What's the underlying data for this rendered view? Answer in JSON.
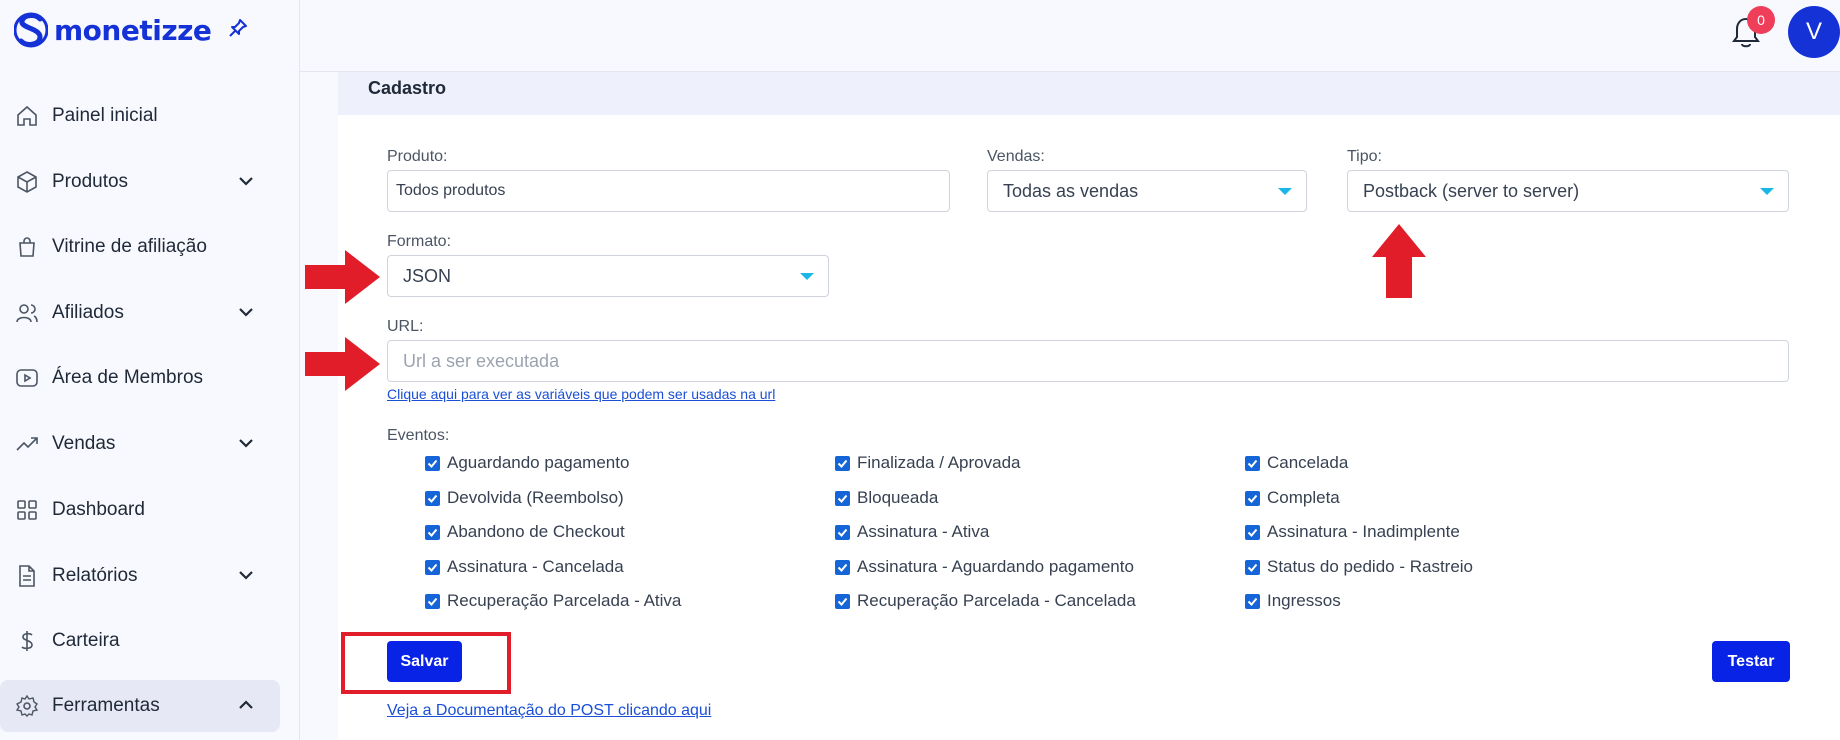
{
  "brand": "monetizze",
  "sidebar": {
    "items": [
      {
        "label": "Painel inicial",
        "icon": "home-icon"
      },
      {
        "label": "Produtos",
        "icon": "box-icon"
      },
      {
        "label": "Vitrine de afiliação",
        "icon": "shopping-bag-icon"
      },
      {
        "label": "Afiliados",
        "icon": "users-icon"
      },
      {
        "label": "Área de Membros",
        "icon": "play-icon"
      },
      {
        "label": "Vendas",
        "icon": "trending-up-icon"
      },
      {
        "label": "Dashboard",
        "icon": "grid-icon"
      },
      {
        "label": "Relatórios",
        "icon": "document-icon"
      },
      {
        "label": "Carteira",
        "icon": "dollar-icon"
      },
      {
        "label": "Ferramentas",
        "icon": "gear-icon"
      }
    ]
  },
  "topbar": {
    "notification_count": "0",
    "avatar_initial": "V"
  },
  "card": {
    "title": "Cadastro"
  },
  "form": {
    "produto_label": "Produto:",
    "produto_value": "Todos produtos",
    "vendas_label": "Vendas:",
    "vendas_value": "Todas as vendas",
    "tipo_label": "Tipo:",
    "tipo_value": "Postback (server to server)",
    "formato_label": "Formato:",
    "formato_value": "JSON",
    "url_label": "URL:",
    "url_placeholder": "Url a ser executada",
    "url_help_link": "Clique aqui para ver as variáveis que podem ser usadas na url",
    "eventos_label": "Eventos:"
  },
  "events": {
    "col1": [
      "Aguardando pagamento",
      "Devolvida (Reembolso)",
      "Abandono de Checkout",
      "Assinatura - Cancelada",
      "Recuperação Parcelada - Ativa"
    ],
    "col2": [
      "Finalizada / Aprovada",
      "Bloqueada",
      "Assinatura - Ativa",
      "Assinatura - Aguardando pagamento",
      "Recuperação Parcelada - Cancelada"
    ],
    "col3": [
      "Cancelada",
      "Completa",
      "Assinatura - Inadimplente",
      "Status do pedido - Rastreio",
      "Ingressos"
    ]
  },
  "buttons": {
    "save": "Salvar",
    "test": "Testar"
  },
  "doc_link": "Veja a Documentação do POST clicando aqui",
  "colors": {
    "brand": "#1532d6",
    "button": "#0822e6",
    "annotation": "#e11d2a",
    "checkbox": "#1565d8"
  }
}
